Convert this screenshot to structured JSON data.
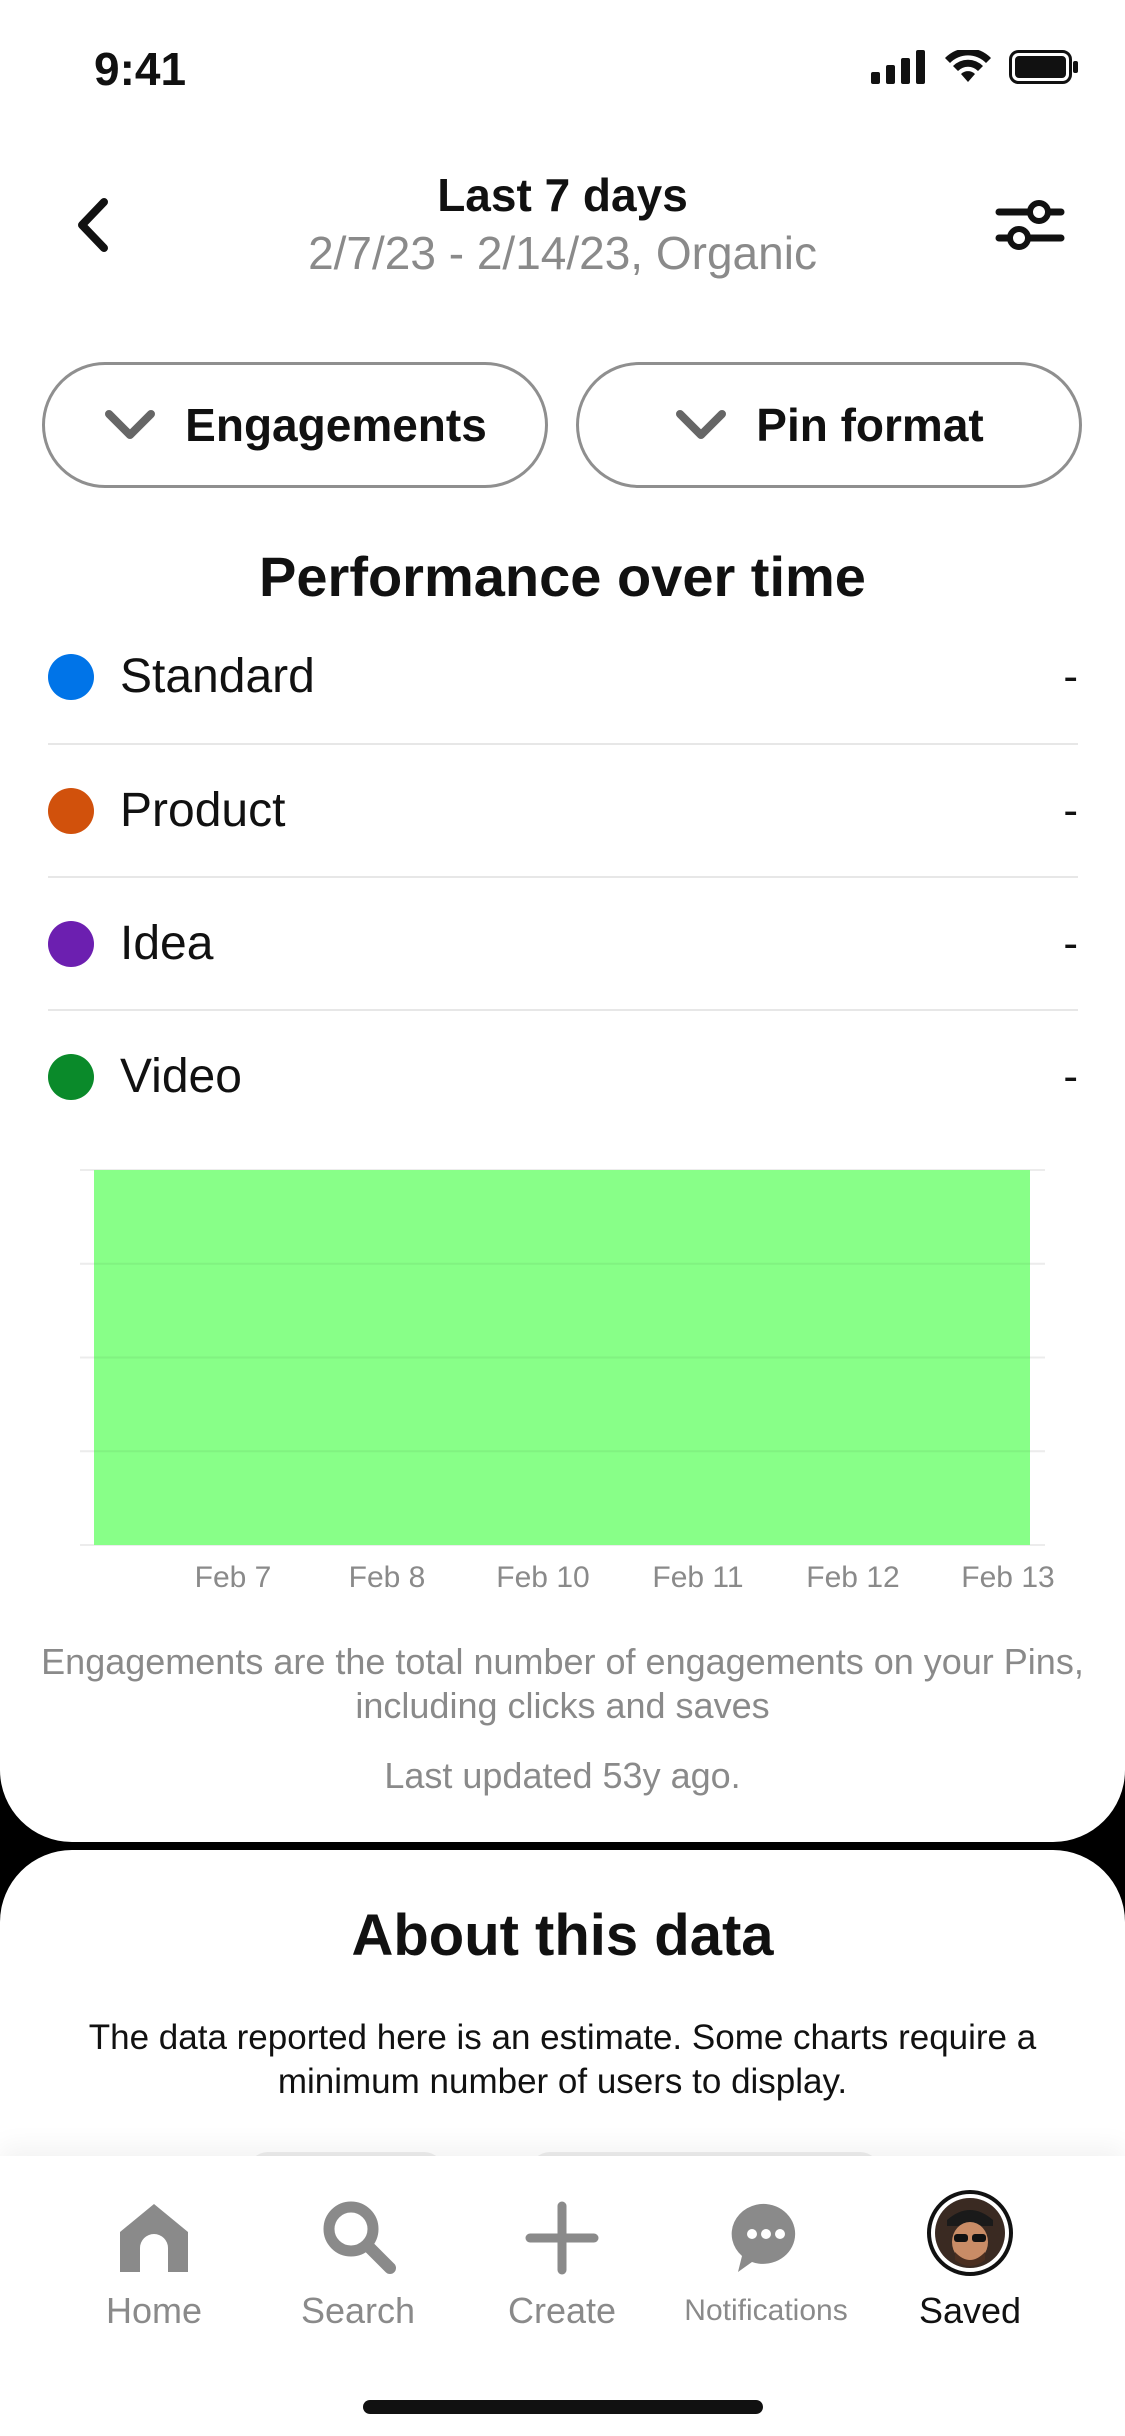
{
  "status": {
    "time": "9:41"
  },
  "header": {
    "title": "Last 7 days",
    "subtitle": "2/7/23 - 2/14/23, Organic"
  },
  "filters": [
    {
      "label": "Engagements"
    },
    {
      "label": "Pin format"
    }
  ],
  "section_title": "Performance over time",
  "legend": [
    {
      "label": "Standard",
      "value": "-",
      "color": "#0074e8"
    },
    {
      "label": "Product",
      "value": "-",
      "color": "#d1510c"
    },
    {
      "label": "Idea",
      "value": "-",
      "color": "#6c1fb0"
    },
    {
      "label": "Video",
      "value": "-",
      "color": "#0a8a2a"
    }
  ],
  "chart_data": {
    "type": "area",
    "categories": [
      "Feb 7",
      "Feb 8",
      "Feb 10",
      "Feb 11",
      "Feb 12",
      "Feb 13"
    ],
    "series": [
      {
        "name": "Video",
        "color": "#88ff88",
        "values": [
          null,
          null,
          null,
          null,
          null,
          null
        ]
      }
    ],
    "grid": true,
    "fill_color": "#88ff88"
  },
  "footnote": "Engagements are the total number of engagements on your Pins, including clicks and saves",
  "last_updated": "Last updated 53y ago.",
  "about": {
    "title": "About this data",
    "text": "The data reported here is an estimate. Some charts require a minimum number of users to display."
  },
  "tabbar": [
    {
      "label": "Home",
      "icon": "home-icon"
    },
    {
      "label": "Search",
      "icon": "search-icon"
    },
    {
      "label": "Create",
      "icon": "plus-icon"
    },
    {
      "label": "Notifications",
      "icon": "chat-bubble-icon"
    },
    {
      "label": "Saved",
      "icon": "avatar",
      "active": true
    }
  ]
}
